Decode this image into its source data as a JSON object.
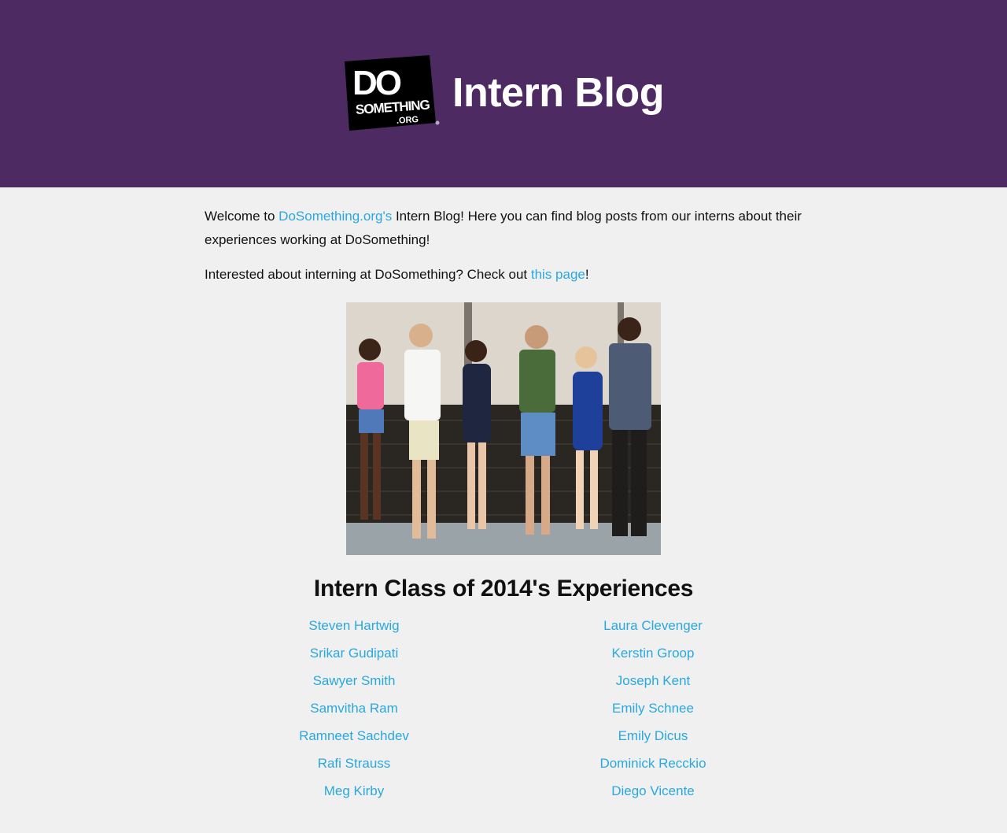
{
  "header": {
    "logo_text": "DO SOMETHING .ORG",
    "title": "Intern Blog"
  },
  "intro": {
    "p1_prefix": "Welcome to ",
    "p1_link": "DoSomething.org's",
    "p1_suffix": " Intern Blog! Here you can find blog posts from our interns about their experiences working at DoSomething!",
    "p2_prefix": "Interested about interning at DoSomething? Check out ",
    "p2_link": "this page",
    "p2_suffix": "!"
  },
  "section": {
    "title": "Intern Class of 2014's Experiences"
  },
  "interns": {
    "left": [
      "Steven Hartwig",
      "Srikar Gudipati",
      "Sawyer Smith",
      "Samvitha Ram",
      "Ramneet Sachdev",
      "Rafi Strauss",
      "Meg Kirby"
    ],
    "right": [
      "Laura Clevenger",
      "Kerstin Groop",
      "Joseph Kent",
      "Emily Schnee",
      "Emily Dicus",
      "Dominick Recckio",
      "Diego Vicente"
    ]
  },
  "colors": {
    "header_bg": "#4e2a63",
    "link": "#29a8e0",
    "page_bg": "#f0f0f0"
  },
  "icons": {
    "logo": "dosomething-logo",
    "photo": "intern-group-photo"
  }
}
